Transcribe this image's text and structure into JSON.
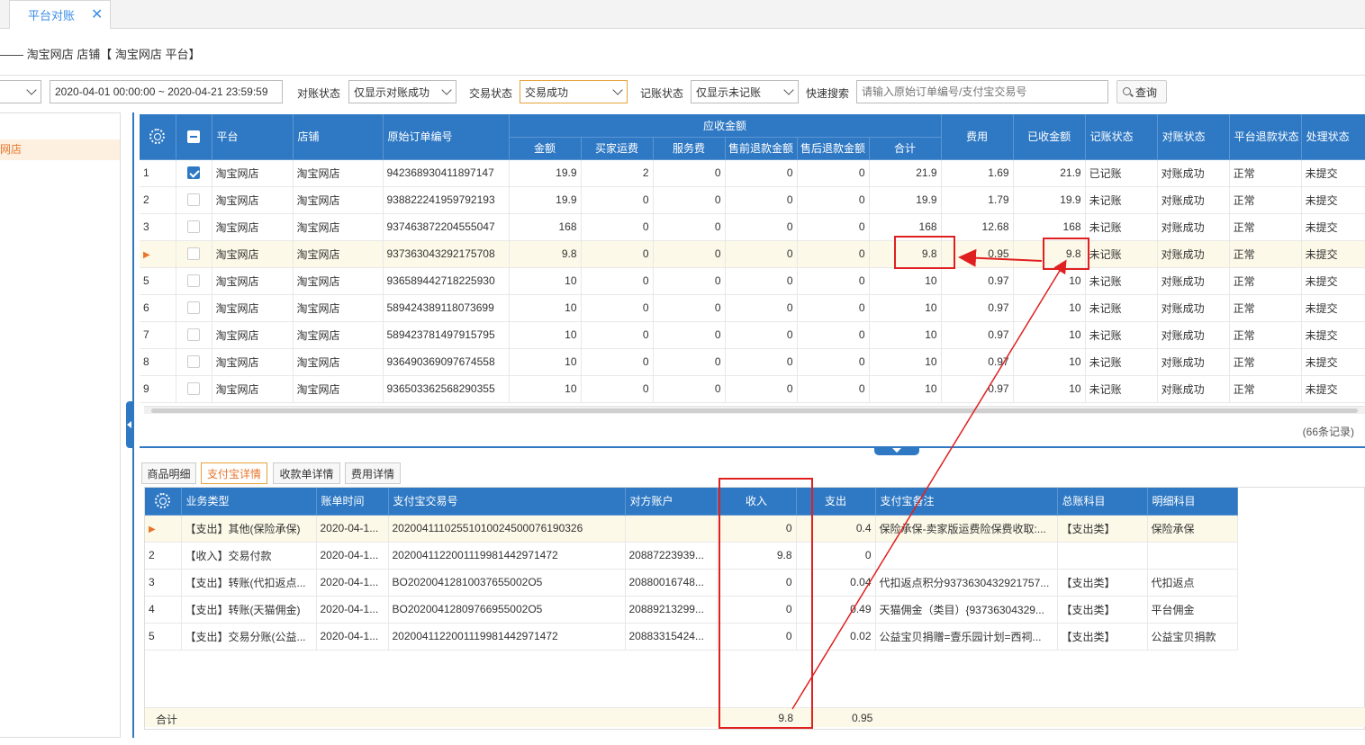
{
  "tab": {
    "title": "平台对账"
  },
  "breadcrumb": "—— 淘宝网店 店铺【 淘宝网店 平台】",
  "filters": {
    "date_range": "2020-04-01 00:00:00 ~ 2020-04-21 23:59:59",
    "recon_label": "对账状态",
    "recon_value": "仅显示对账成功",
    "trade_label": "交易状态",
    "trade_value": "交易成功",
    "book_label": "记账状态",
    "book_value": "仅显示未记账",
    "search_label": "快速搜索",
    "search_placeholder": "请输入原始订单编号/支付宝交易号",
    "query_button": "查询"
  },
  "sidebar": {
    "selected": "网店"
  },
  "main_grid": {
    "group_header": "应收金额",
    "columns": {
      "platform": "平台",
      "shop": "店铺",
      "order_no": "原始订单编号",
      "amount": "金额",
      "buyer_fee": "买家运费",
      "service_fee": "服务费",
      "pre_refund": "售前退款金额",
      "post_refund": "售后退款金额",
      "total": "合计",
      "cost": "费用",
      "received": "已收金额",
      "book_status": "记账状态",
      "recon_status": "对账状态",
      "platform_refund": "平台退款状态",
      "process_status": "处理状态"
    },
    "rows": [
      {
        "idx": "1",
        "checked": true,
        "platform": "淘宝网店",
        "shop": "淘宝网店",
        "order_no": "942368930411897147",
        "amount": "19.9",
        "buyer_fee": "2",
        "service_fee": "0",
        "pre_refund": "0",
        "post_refund": "0",
        "total": "21.9",
        "cost": "1.69",
        "received": "21.9",
        "book_status": "已记账",
        "recon_status": "对账成功",
        "platform_refund": "正常",
        "process_status": "未提交"
      },
      {
        "idx": "2",
        "checked": false,
        "platform": "淘宝网店",
        "shop": "淘宝网店",
        "order_no": "938822241959792193",
        "amount": "19.9",
        "buyer_fee": "0",
        "service_fee": "0",
        "pre_refund": "0",
        "post_refund": "0",
        "total": "19.9",
        "cost": "1.79",
        "received": "19.9",
        "book_status": "未记账",
        "recon_status": "对账成功",
        "platform_refund": "正常",
        "process_status": "未提交"
      },
      {
        "idx": "3",
        "checked": false,
        "platform": "淘宝网店",
        "shop": "淘宝网店",
        "order_no": "937463872204555047",
        "amount": "168",
        "buyer_fee": "0",
        "service_fee": "0",
        "pre_refund": "0",
        "post_refund": "0",
        "total": "168",
        "cost": "12.68",
        "received": "168",
        "book_status": "未记账",
        "recon_status": "对账成功",
        "platform_refund": "正常",
        "process_status": "未提交"
      },
      {
        "idx": "",
        "current": true,
        "checked": false,
        "platform": "淘宝网店",
        "shop": "淘宝网店",
        "order_no": "937363043292175708",
        "amount": "9.8",
        "buyer_fee": "0",
        "service_fee": "0",
        "pre_refund": "0",
        "post_refund": "0",
        "total": "9.8",
        "cost": "0.95",
        "received": "9.8",
        "book_status": "未记账",
        "recon_status": "对账成功",
        "platform_refund": "正常",
        "process_status": "未提交"
      },
      {
        "idx": "5",
        "checked": false,
        "platform": "淘宝网店",
        "shop": "淘宝网店",
        "order_no": "936589442718225930",
        "amount": "10",
        "buyer_fee": "0",
        "service_fee": "0",
        "pre_refund": "0",
        "post_refund": "0",
        "total": "10",
        "cost": "0.97",
        "received": "10",
        "book_status": "未记账",
        "recon_status": "对账成功",
        "platform_refund": "正常",
        "process_status": "未提交"
      },
      {
        "idx": "6",
        "checked": false,
        "platform": "淘宝网店",
        "shop": "淘宝网店",
        "order_no": "589424389118073699",
        "amount": "10",
        "buyer_fee": "0",
        "service_fee": "0",
        "pre_refund": "0",
        "post_refund": "0",
        "total": "10",
        "cost": "0.97",
        "received": "10",
        "book_status": "未记账",
        "recon_status": "对账成功",
        "platform_refund": "正常",
        "process_status": "未提交"
      },
      {
        "idx": "7",
        "checked": false,
        "platform": "淘宝网店",
        "shop": "淘宝网店",
        "order_no": "589423781497915795",
        "amount": "10",
        "buyer_fee": "0",
        "service_fee": "0",
        "pre_refund": "0",
        "post_refund": "0",
        "total": "10",
        "cost": "0.97",
        "received": "10",
        "book_status": "未记账",
        "recon_status": "对账成功",
        "platform_refund": "正常",
        "process_status": "未提交"
      },
      {
        "idx": "8",
        "checked": false,
        "platform": "淘宝网店",
        "shop": "淘宝网店",
        "order_no": "936490369097674558",
        "amount": "10",
        "buyer_fee": "0",
        "service_fee": "0",
        "pre_refund": "0",
        "post_refund": "0",
        "total": "10",
        "cost": "0.97",
        "received": "10",
        "book_status": "未记账",
        "recon_status": "对账成功",
        "platform_refund": "正常",
        "process_status": "未提交"
      },
      {
        "idx": "9",
        "checked": false,
        "platform": "淘宝网店",
        "shop": "淘宝网店",
        "order_no": "936503362568290355",
        "amount": "10",
        "buyer_fee": "0",
        "service_fee": "0",
        "pre_refund": "0",
        "post_refund": "0",
        "total": "10",
        "cost": "0.97",
        "received": "10",
        "book_status": "未记账",
        "recon_status": "对账成功",
        "platform_refund": "正常",
        "process_status": "未提交"
      }
    ],
    "record_count": "(66条记录)"
  },
  "sub_tabs": [
    "商品明细",
    "支付宝详情",
    "收款单详情",
    "费用详情"
  ],
  "detail_grid": {
    "columns": {
      "biz_type": "业务类型",
      "bill_time": "账单时间",
      "trade_no": "支付宝交易号",
      "counter": "对方账户",
      "income": "收入",
      "expense": "支出",
      "remark": "支付宝备注",
      "gl": "总账科目",
      "detail": "明细科目"
    },
    "rows": [
      {
        "idx": "",
        "current": true,
        "biz_type": "【支出】其他(保险承保)",
        "bill_time": "2020-04-1...",
        "trade_no": "20200411102551010024500076190326",
        "counter": "",
        "income": "0",
        "expense": "0.4",
        "remark": "保险承保-卖家版运费险保费收取:...",
        "gl": "【支出类】",
        "detail": "保险承保"
      },
      {
        "idx": "2",
        "biz_type": "【收入】交易付款",
        "bill_time": "2020-04-1...",
        "trade_no": "2020041122001119981442971472",
        "counter": "20887223939...",
        "income": "9.8",
        "expense": "0",
        "remark": "",
        "gl": "",
        "detail": ""
      },
      {
        "idx": "3",
        "biz_type": "【支出】转账(代扣返点...",
        "bill_time": "2020-04-1...",
        "trade_no": "BO20200412810037655002O5",
        "counter": "20880016748...",
        "income": "0",
        "expense": "0.04",
        "remark": "代扣返点积分9373630432921757...",
        "gl": "【支出类】",
        "detail": "代扣返点"
      },
      {
        "idx": "4",
        "biz_type": "【支出】转账(天猫佣金)",
        "bill_time": "2020-04-1...",
        "trade_no": "BO20200412809766955002O5",
        "counter": "20889213299...",
        "income": "0",
        "expense": "0.49",
        "remark": "天猫佣金（类目）{93736304329...",
        "gl": "【支出类】",
        "detail": "平台佣金"
      },
      {
        "idx": "5",
        "biz_type": "【支出】交易分账(公益...",
        "bill_time": "2020-04-1...",
        "trade_no": "2020041122001119981442971472",
        "counter": "20883315424...",
        "income": "0",
        "expense": "0.02",
        "remark": "公益宝贝捐赠=壹乐园计划=西祠...",
        "gl": "【支出类】",
        "detail": "公益宝贝捐款"
      }
    ],
    "summary": {
      "label": "合计",
      "income": "9.8",
      "expense": "0.95"
    }
  },
  "colors": {
    "header_blue": "#2f79c4",
    "accent_orange": "#e6762c",
    "success_green": "#1aa34a",
    "annotation_red": "#e02020"
  }
}
